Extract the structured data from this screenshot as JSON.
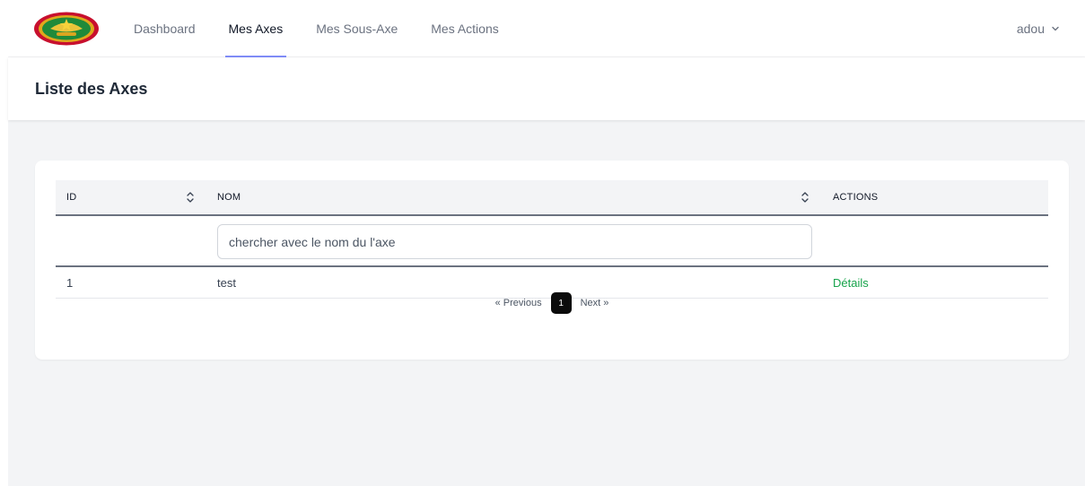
{
  "nav": {
    "items": [
      {
        "label": "Dashboard",
        "active": false
      },
      {
        "label": "Mes Axes",
        "active": true
      },
      {
        "label": "Mes Sous-Axe",
        "active": false
      },
      {
        "label": "Mes Actions",
        "active": false
      }
    ],
    "user": "adou"
  },
  "page": {
    "title": "Liste des Axes"
  },
  "table": {
    "columns": [
      "ID",
      "NOM",
      "ACTIONS"
    ],
    "search_placeholder": "chercher avec le nom du l'axe",
    "rows": [
      {
        "id": "1",
        "nom": "test",
        "action": "Détails"
      }
    ]
  },
  "pagination": {
    "prev": "« Previous",
    "current": "1",
    "next": "Next »"
  },
  "colors": {
    "accent": "#818cf8",
    "link_green": "#16a34a",
    "page_active": "#0b0b0b"
  }
}
